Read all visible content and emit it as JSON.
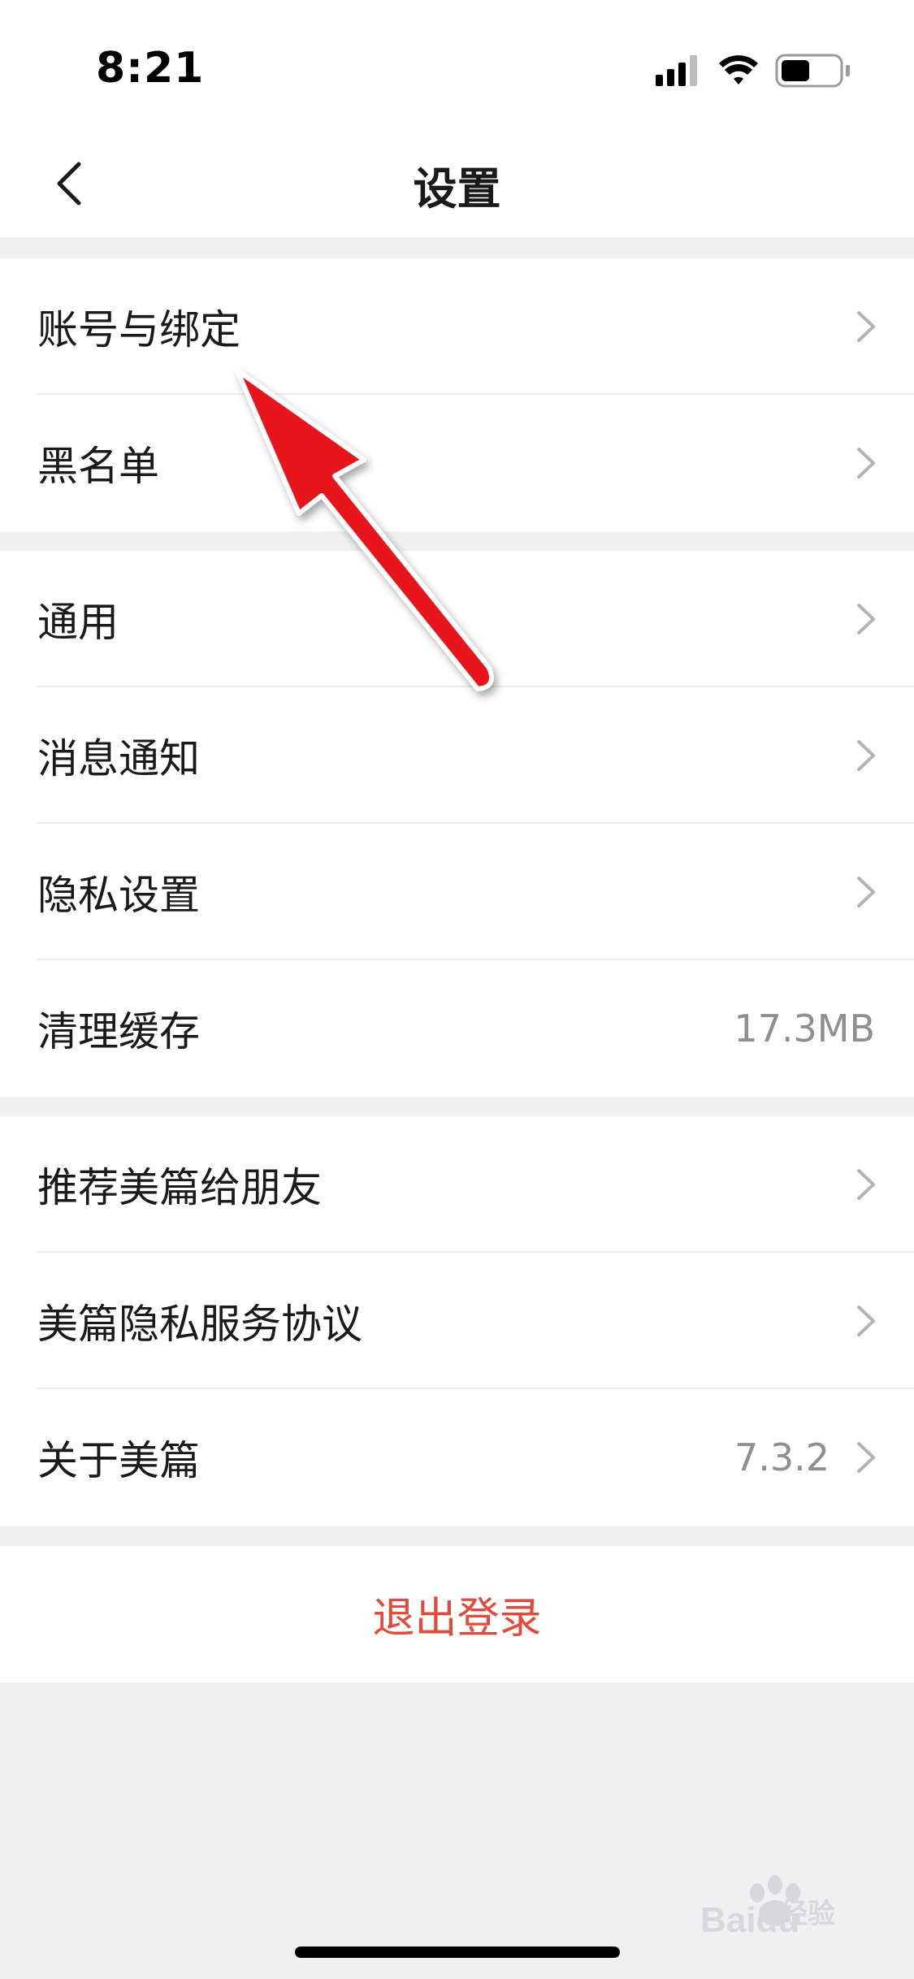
{
  "status_bar": {
    "time": "8:21",
    "icons": [
      "signal-icon",
      "wifi-icon",
      "battery-icon"
    ]
  },
  "nav": {
    "title": "设置",
    "back_icon": "chevron-left-icon"
  },
  "groups": [
    {
      "items": [
        {
          "label": "账号与绑定",
          "value": "",
          "chevron": true
        },
        {
          "label": "黑名单",
          "value": "",
          "chevron": true
        }
      ]
    },
    {
      "items": [
        {
          "label": "通用",
          "value": "",
          "chevron": true
        },
        {
          "label": "消息通知",
          "value": "",
          "chevron": true
        },
        {
          "label": "隐私设置",
          "value": "",
          "chevron": true
        },
        {
          "label": "清理缓存",
          "value": "17.3MB",
          "chevron": false
        }
      ]
    },
    {
      "items": [
        {
          "label": "推荐美篇给朋友",
          "value": "",
          "chevron": true
        },
        {
          "label": "美篇隐私服务协议",
          "value": "",
          "chevron": true
        },
        {
          "label": "关于美篇",
          "value": "7.3.2",
          "chevron": true
        }
      ]
    }
  ],
  "logout": {
    "label": "退出登录"
  },
  "watermark": {
    "text": "经验",
    "brand": "Baidu"
  },
  "colors": {
    "background": "#f0f0f3",
    "surface": "#ffffff",
    "logout_red": "#e14b3b",
    "annotation_arrow": "#e8121b",
    "secondary_text": "#8e8e93"
  }
}
